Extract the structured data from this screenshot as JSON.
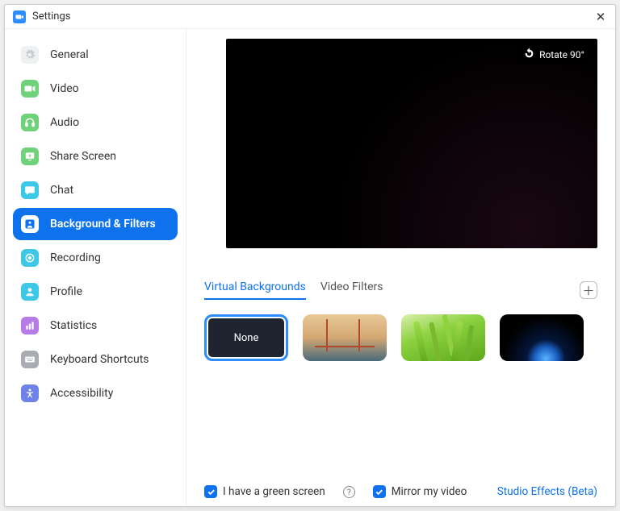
{
  "window": {
    "title": "Settings"
  },
  "sidebar": {
    "items": [
      {
        "label": "General"
      },
      {
        "label": "Video"
      },
      {
        "label": "Audio"
      },
      {
        "label": "Share Screen"
      },
      {
        "label": "Chat"
      },
      {
        "label": "Background & Filters"
      },
      {
        "label": "Recording"
      },
      {
        "label": "Profile"
      },
      {
        "label": "Statistics"
      },
      {
        "label": "Keyboard Shortcuts"
      },
      {
        "label": "Accessibility"
      }
    ],
    "active_index": 5
  },
  "preview": {
    "rotate_label": "Rotate 90°"
  },
  "tabs": {
    "items": [
      {
        "label": "Virtual Backgrounds"
      },
      {
        "label": "Video Filters"
      }
    ],
    "active_index": 0
  },
  "backgrounds": {
    "none_label": "None",
    "selected_index": 0
  },
  "footer": {
    "green_screen_label": "I have a green screen",
    "mirror_label": "Mirror my video",
    "studio_label": "Studio Effects (Beta)",
    "green_screen_checked": true,
    "mirror_checked": true
  },
  "colors": {
    "accent": "#0E72ED"
  }
}
